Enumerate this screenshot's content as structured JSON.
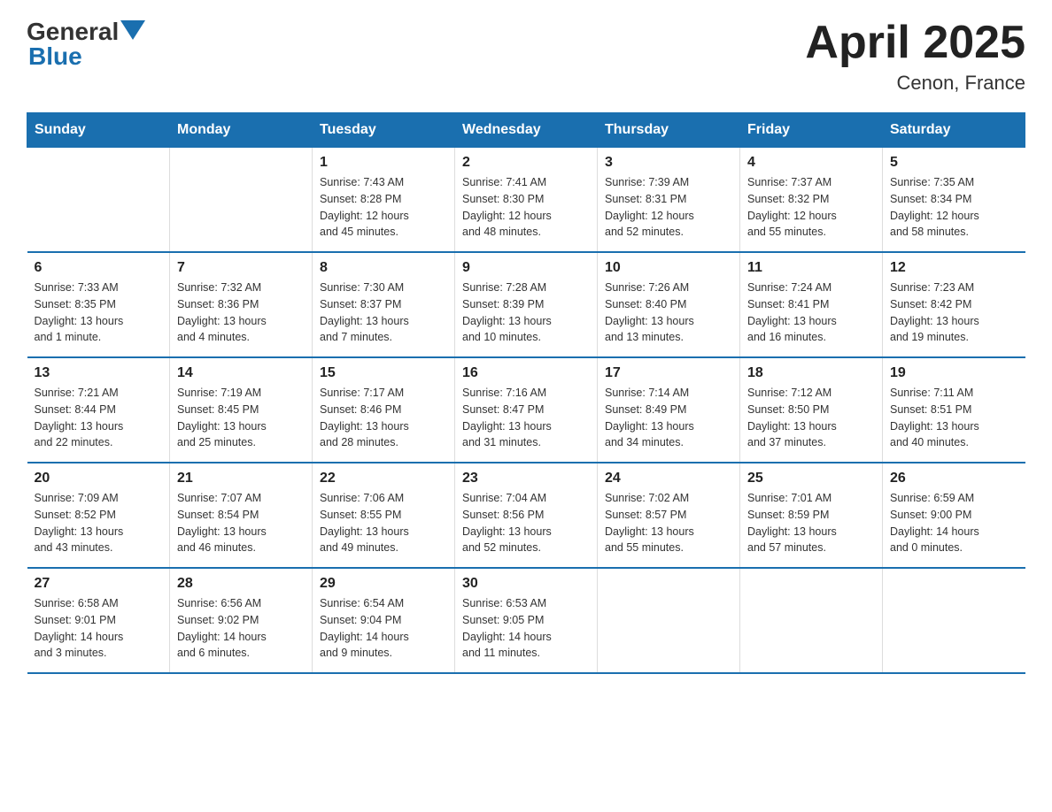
{
  "header": {
    "logo_general": "General",
    "logo_blue": "Blue",
    "title": "April 2025",
    "subtitle": "Cenon, France"
  },
  "days_of_week": [
    "Sunday",
    "Monday",
    "Tuesday",
    "Wednesday",
    "Thursday",
    "Friday",
    "Saturday"
  ],
  "weeks": [
    [
      {
        "day": "",
        "info": ""
      },
      {
        "day": "",
        "info": ""
      },
      {
        "day": "1",
        "info": "Sunrise: 7:43 AM\nSunset: 8:28 PM\nDaylight: 12 hours\nand 45 minutes."
      },
      {
        "day": "2",
        "info": "Sunrise: 7:41 AM\nSunset: 8:30 PM\nDaylight: 12 hours\nand 48 minutes."
      },
      {
        "day": "3",
        "info": "Sunrise: 7:39 AM\nSunset: 8:31 PM\nDaylight: 12 hours\nand 52 minutes."
      },
      {
        "day": "4",
        "info": "Sunrise: 7:37 AM\nSunset: 8:32 PM\nDaylight: 12 hours\nand 55 minutes."
      },
      {
        "day": "5",
        "info": "Sunrise: 7:35 AM\nSunset: 8:34 PM\nDaylight: 12 hours\nand 58 minutes."
      }
    ],
    [
      {
        "day": "6",
        "info": "Sunrise: 7:33 AM\nSunset: 8:35 PM\nDaylight: 13 hours\nand 1 minute."
      },
      {
        "day": "7",
        "info": "Sunrise: 7:32 AM\nSunset: 8:36 PM\nDaylight: 13 hours\nand 4 minutes."
      },
      {
        "day": "8",
        "info": "Sunrise: 7:30 AM\nSunset: 8:37 PM\nDaylight: 13 hours\nand 7 minutes."
      },
      {
        "day": "9",
        "info": "Sunrise: 7:28 AM\nSunset: 8:39 PM\nDaylight: 13 hours\nand 10 minutes."
      },
      {
        "day": "10",
        "info": "Sunrise: 7:26 AM\nSunset: 8:40 PM\nDaylight: 13 hours\nand 13 minutes."
      },
      {
        "day": "11",
        "info": "Sunrise: 7:24 AM\nSunset: 8:41 PM\nDaylight: 13 hours\nand 16 minutes."
      },
      {
        "day": "12",
        "info": "Sunrise: 7:23 AM\nSunset: 8:42 PM\nDaylight: 13 hours\nand 19 minutes."
      }
    ],
    [
      {
        "day": "13",
        "info": "Sunrise: 7:21 AM\nSunset: 8:44 PM\nDaylight: 13 hours\nand 22 minutes."
      },
      {
        "day": "14",
        "info": "Sunrise: 7:19 AM\nSunset: 8:45 PM\nDaylight: 13 hours\nand 25 minutes."
      },
      {
        "day": "15",
        "info": "Sunrise: 7:17 AM\nSunset: 8:46 PM\nDaylight: 13 hours\nand 28 minutes."
      },
      {
        "day": "16",
        "info": "Sunrise: 7:16 AM\nSunset: 8:47 PM\nDaylight: 13 hours\nand 31 minutes."
      },
      {
        "day": "17",
        "info": "Sunrise: 7:14 AM\nSunset: 8:49 PM\nDaylight: 13 hours\nand 34 minutes."
      },
      {
        "day": "18",
        "info": "Sunrise: 7:12 AM\nSunset: 8:50 PM\nDaylight: 13 hours\nand 37 minutes."
      },
      {
        "day": "19",
        "info": "Sunrise: 7:11 AM\nSunset: 8:51 PM\nDaylight: 13 hours\nand 40 minutes."
      }
    ],
    [
      {
        "day": "20",
        "info": "Sunrise: 7:09 AM\nSunset: 8:52 PM\nDaylight: 13 hours\nand 43 minutes."
      },
      {
        "day": "21",
        "info": "Sunrise: 7:07 AM\nSunset: 8:54 PM\nDaylight: 13 hours\nand 46 minutes."
      },
      {
        "day": "22",
        "info": "Sunrise: 7:06 AM\nSunset: 8:55 PM\nDaylight: 13 hours\nand 49 minutes."
      },
      {
        "day": "23",
        "info": "Sunrise: 7:04 AM\nSunset: 8:56 PM\nDaylight: 13 hours\nand 52 minutes."
      },
      {
        "day": "24",
        "info": "Sunrise: 7:02 AM\nSunset: 8:57 PM\nDaylight: 13 hours\nand 55 minutes."
      },
      {
        "day": "25",
        "info": "Sunrise: 7:01 AM\nSunset: 8:59 PM\nDaylight: 13 hours\nand 57 minutes."
      },
      {
        "day": "26",
        "info": "Sunrise: 6:59 AM\nSunset: 9:00 PM\nDaylight: 14 hours\nand 0 minutes."
      }
    ],
    [
      {
        "day": "27",
        "info": "Sunrise: 6:58 AM\nSunset: 9:01 PM\nDaylight: 14 hours\nand 3 minutes."
      },
      {
        "day": "28",
        "info": "Sunrise: 6:56 AM\nSunset: 9:02 PM\nDaylight: 14 hours\nand 6 minutes."
      },
      {
        "day": "29",
        "info": "Sunrise: 6:54 AM\nSunset: 9:04 PM\nDaylight: 14 hours\nand 9 minutes."
      },
      {
        "day": "30",
        "info": "Sunrise: 6:53 AM\nSunset: 9:05 PM\nDaylight: 14 hours\nand 11 minutes."
      },
      {
        "day": "",
        "info": ""
      },
      {
        "day": "",
        "info": ""
      },
      {
        "day": "",
        "info": ""
      }
    ]
  ]
}
